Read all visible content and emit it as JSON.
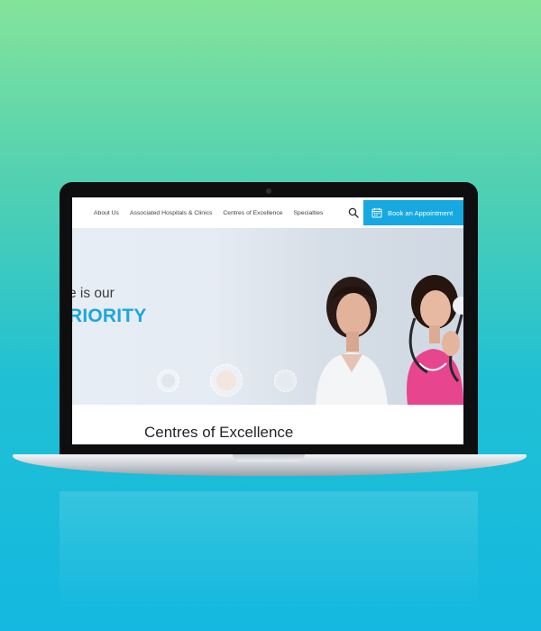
{
  "header": {
    "nav": [
      "About Us",
      "Associated Hospitals & Clinics",
      "Centres of Excellence",
      "Specialties"
    ],
    "cta_label": "Book an Appointment"
  },
  "hero": {
    "line1": "e is our",
    "line2": "RIORITY"
  },
  "section": {
    "title": "Centres of Excellence"
  },
  "colors": {
    "accent": "#16a9e1",
    "background_top": "#84e39a",
    "background_bottom": "#14b8e0"
  },
  "icons": [
    "search-icon",
    "calendar-icon"
  ]
}
